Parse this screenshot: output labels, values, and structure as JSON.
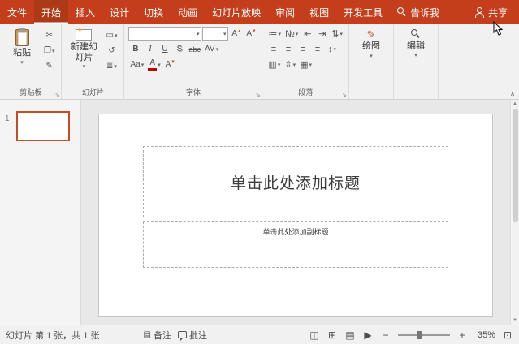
{
  "colors": {
    "accent": "#C43E1C",
    "tab_active_bg": "#AD3A17",
    "thumbnail_selection_border": "#C84B24",
    "font_color_swatch": "#C00000"
  },
  "tabs": {
    "items": [
      {
        "label": "文件"
      },
      {
        "label": "开始"
      },
      {
        "label": "插入"
      },
      {
        "label": "设计"
      },
      {
        "label": "切换"
      },
      {
        "label": "动画"
      },
      {
        "label": "幻灯片放映"
      },
      {
        "label": "审阅"
      },
      {
        "label": "视图"
      },
      {
        "label": "开发工具"
      },
      {
        "label": "告诉我"
      }
    ],
    "share_label": "共享"
  },
  "ribbon": {
    "clipboard": {
      "group_label": "剪贴板",
      "paste_label": "粘贴"
    },
    "slides": {
      "group_label": "幻灯片",
      "new_slide_label": "新建幻灯片"
    },
    "font": {
      "group_label": "字体",
      "font_name_value": "",
      "font_size_value": "",
      "bold": "B",
      "italic": "I",
      "underline": "U",
      "shadow": "S",
      "strikethrough": "abc",
      "char_spacing": "AV",
      "change_case": "Aa",
      "grow": "A",
      "shrink": "A",
      "color": "A",
      "clear": "A"
    },
    "paragraph": {
      "group_label": "段落"
    },
    "drawing_label": "绘图",
    "editing_label": "编辑"
  },
  "slide_panel": {
    "slide_number": "1"
  },
  "slide": {
    "title_placeholder": "单击此处添加标题",
    "subtitle_placeholder": "单击此处添加副标题"
  },
  "statusbar": {
    "slide_info": "幻灯片 第 1 张，共 1 张",
    "notes_label": "备注",
    "comments_label": "批注",
    "zoom_level": "35%"
  },
  "icons": {
    "dropdown": "▾",
    "cut": "✂",
    "copy": "❐",
    "format_painter": "✎",
    "layout": "▭",
    "reset": "↺",
    "section": "≣",
    "up": "▴",
    "down": "▾",
    "bullets": "≔",
    "numbering": "№",
    "outdent": "⇤",
    "indent": "⇥",
    "text_direction": "⇅",
    "align_lines": "≡",
    "line_spacing": "↕",
    "columns": "▥",
    "align_text": "⇳",
    "smartart": "▦",
    "pencil": "✎",
    "launcher": "⇘",
    "collapse": "∧",
    "notes": "▤",
    "view_normal": "◫",
    "view_sorter": "⊞",
    "view_reading": "▤",
    "view_slideshow": "▶",
    "zoom_out": "−",
    "zoom_in": "+",
    "fit": "⊡",
    "scroll_up": "▲",
    "scroll_down": "▼",
    "star": "✦"
  }
}
